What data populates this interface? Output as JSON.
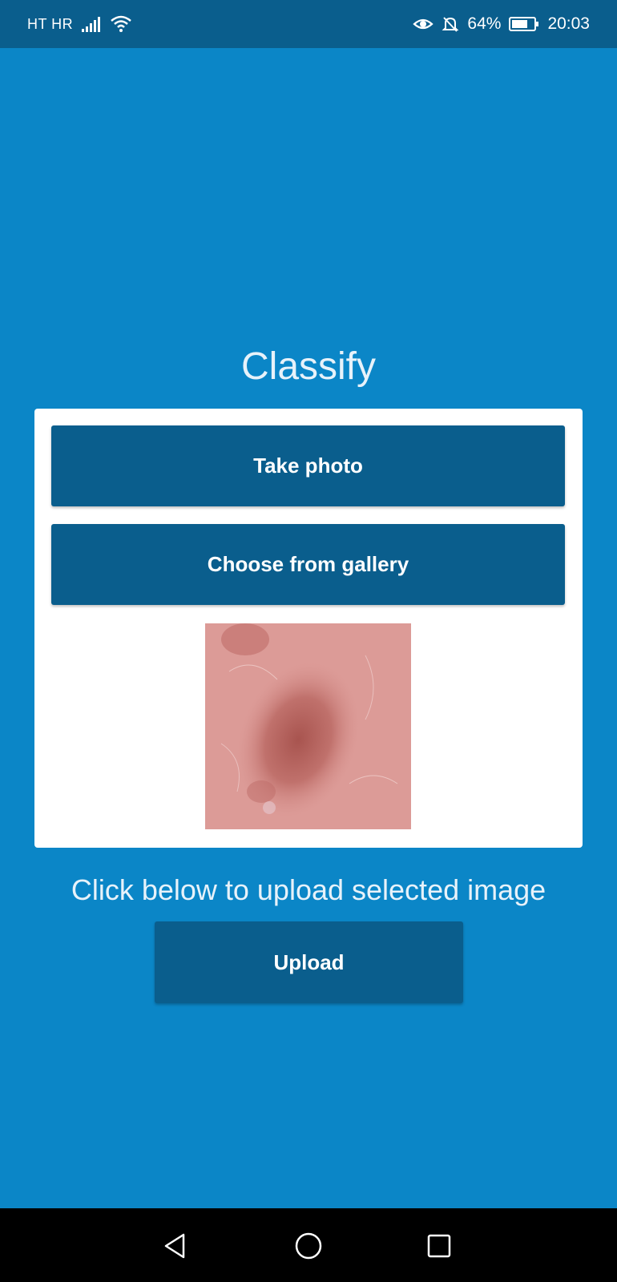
{
  "status_bar": {
    "carrier": "HT HR",
    "battery": "64%",
    "time": "20:03",
    "icons": [
      "signal-icon",
      "wifi-icon",
      "eye-icon",
      "bell-off-icon",
      "battery-icon"
    ]
  },
  "main": {
    "title": "Classify",
    "take_photo_label": "Take photo",
    "gallery_label": "Choose from gallery",
    "hint": "Click below to upload selected image",
    "upload_label": "Upload"
  },
  "nav_bar": {
    "icons": [
      "back-icon",
      "home-icon",
      "recents-icon"
    ]
  },
  "colors": {
    "background": "#0b86c7",
    "bar": "#0a5e8d",
    "button": "#0a5e8d",
    "card": "#ffffff",
    "nav": "#000000"
  }
}
